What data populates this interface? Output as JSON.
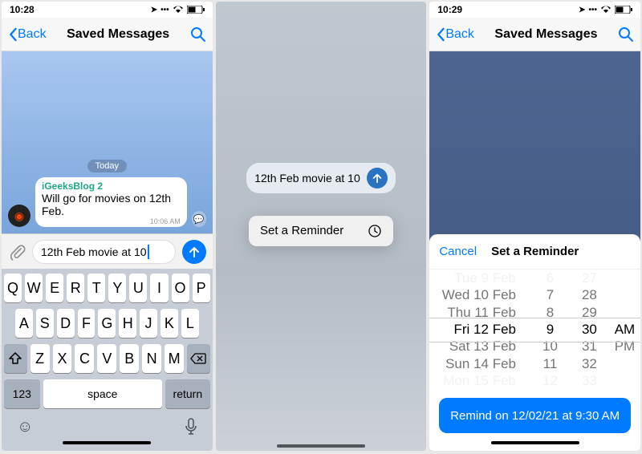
{
  "s1": {
    "time": "10:28",
    "back": "Back",
    "title": "Saved Messages",
    "date_pill": "Today",
    "msg_sender": "iGeeksBlog 2",
    "msg_text": "Will go for movies on 12th Feb.",
    "msg_time": "10:06 AM",
    "input_value": "12th Feb movie at 10",
    "kbd": {
      "r1": [
        "Q",
        "W",
        "E",
        "R",
        "T",
        "Y",
        "U",
        "I",
        "O",
        "P"
      ],
      "r2": [
        "A",
        "S",
        "D",
        "F",
        "G",
        "H",
        "J",
        "K",
        "L"
      ],
      "r3": [
        "Z",
        "X",
        "C",
        "V",
        "B",
        "N",
        "M"
      ],
      "n123": "123",
      "space": "space",
      "return": "return"
    }
  },
  "s2": {
    "draft": "12th Feb movie at 10",
    "menu": "Set a Reminder"
  },
  "s3": {
    "time": "10:29",
    "back": "Back",
    "title": "Saved Messages",
    "sheet_cancel": "Cancel",
    "sheet_title": "Set a Reminder",
    "picker": {
      "dates": [
        "Tue 9 Feb",
        "Wed 10 Feb",
        "Thu 11 Feb",
        "Fri 12 Feb",
        "Sat 13 Feb",
        "Sun 14 Feb",
        "Mon 15 Feb"
      ],
      "hours": [
        "6",
        "7",
        "8",
        "9",
        "10",
        "11",
        "12"
      ],
      "minutes": [
        "27",
        "28",
        "29",
        "30",
        "31",
        "32",
        "33"
      ],
      "ampm": [
        "AM",
        "PM"
      ],
      "selected_date": "Fri 12 Feb",
      "selected_hour": "9",
      "selected_minute": "30",
      "selected_ampm": "AM"
    },
    "remind_btn": "Remind on 12/02/21 at 9:30 AM"
  }
}
